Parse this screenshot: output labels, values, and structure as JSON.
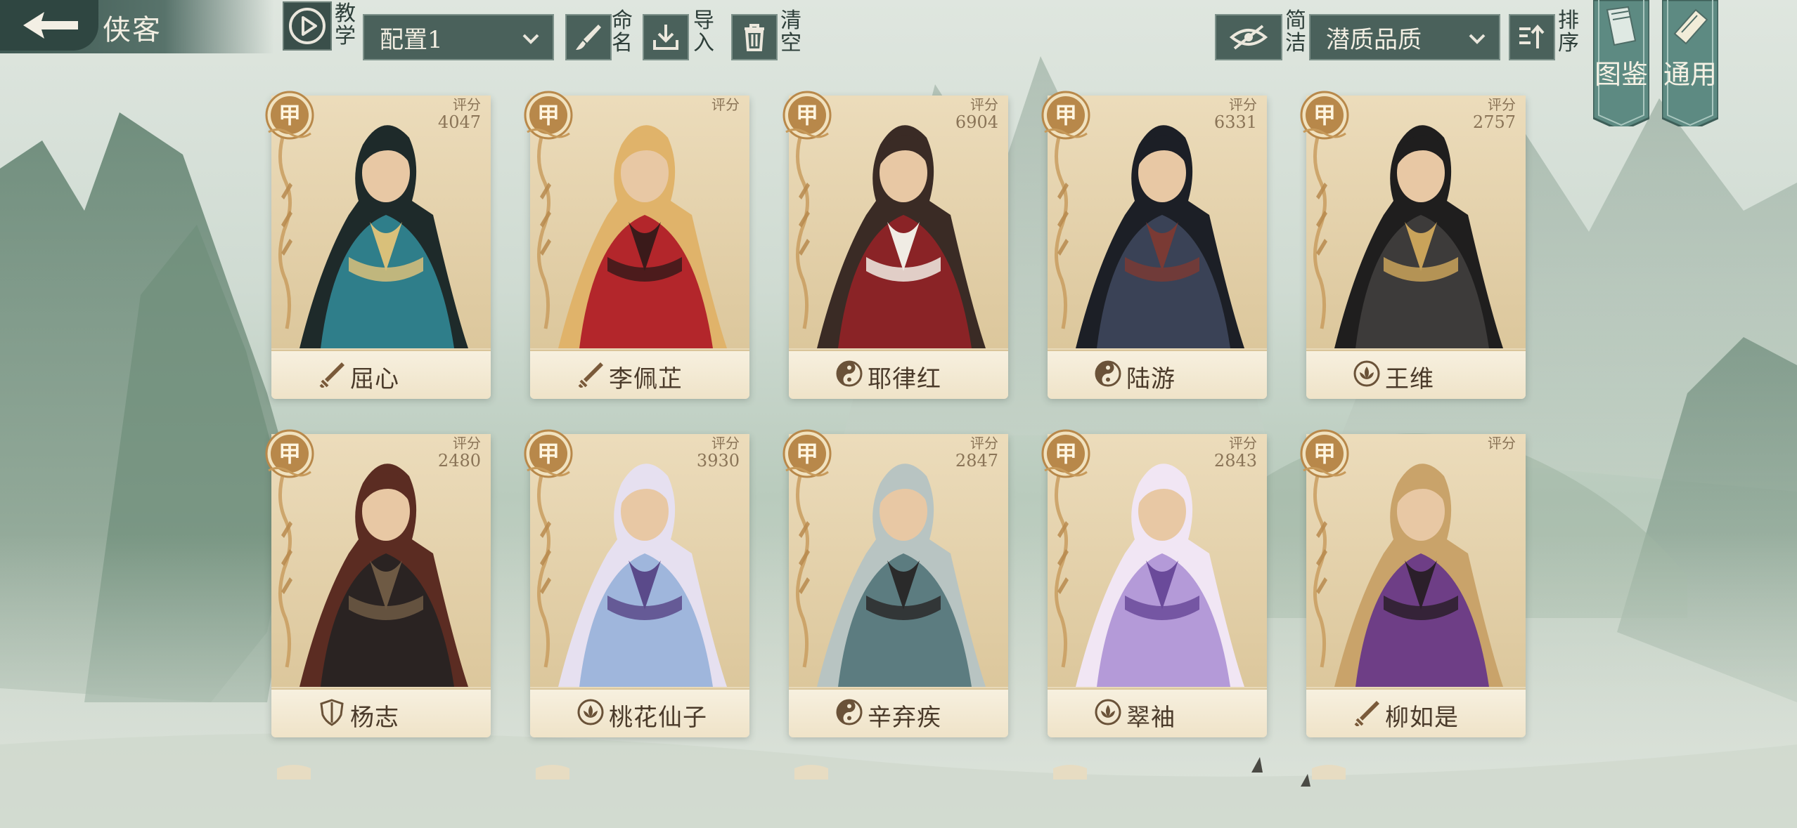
{
  "header": {
    "title": "侠客",
    "tutorial_label": "教学",
    "config_select": "配置1",
    "rename_label": "命名",
    "import_label": "导入",
    "clear_label": "清空",
    "simple_label": "简洁",
    "sort_select": "潜质品质",
    "sort_label": "排序",
    "catalog_label": "图鉴",
    "general_label": "通用"
  },
  "score_label": "评分",
  "cards": [
    {
      "grade": "甲",
      "score": "4047",
      "name": "屈心",
      "type_icon": "sword-icon",
      "palette": [
        "#2f7e8a",
        "#d9c07a",
        "#1e2a2a"
      ]
    },
    {
      "grade": "甲",
      "score": "",
      "name": "李佩芷",
      "type_icon": "sword-icon",
      "palette": [
        "#b3262b",
        "#3a1a1a",
        "#e0b36a"
      ]
    },
    {
      "grade": "甲",
      "score": "6904",
      "name": "耶律红",
      "type_icon": "yinyang-icon",
      "palette": [
        "#8a2326",
        "#f0ece4",
        "#3a2b25"
      ]
    },
    {
      "grade": "甲",
      "score": "6331",
      "name": "陆游",
      "type_icon": "yinyang-icon",
      "palette": [
        "#3a4256",
        "#7a3a34",
        "#1c1f26"
      ]
    },
    {
      "grade": "甲",
      "score": "2757",
      "name": "王维",
      "type_icon": "lotus-icon",
      "palette": [
        "#3d3b3a",
        "#c9a35a",
        "#1f1e1e"
      ]
    },
    {
      "grade": "甲",
      "score": "2480",
      "name": "杨志",
      "type_icon": "shield-icon",
      "palette": [
        "#2a2322",
        "#6e5a44",
        "#5b2c22"
      ]
    },
    {
      "grade": "甲",
      "score": "3930",
      "name": "桃花仙子",
      "type_icon": "lotus-icon",
      "palette": [
        "#9fb6dc",
        "#5a4a8a",
        "#e6e0f0"
      ]
    },
    {
      "grade": "甲",
      "score": "2847",
      "name": "辛弃疾",
      "type_icon": "yinyang-icon",
      "palette": [
        "#5c7c80",
        "#2a2a2a",
        "#b8c4c2"
      ]
    },
    {
      "grade": "甲",
      "score": "2843",
      "name": "翠袖",
      "type_icon": "lotus-icon",
      "palette": [
        "#b49ad8",
        "#6a4a9a",
        "#f1e6f4"
      ]
    },
    {
      "grade": "甲",
      "score": "",
      "name": "柳如是",
      "type_icon": "sword-icon",
      "palette": [
        "#6e3e86",
        "#2b1f2a",
        "#c9a36a"
      ]
    }
  ],
  "colors": {
    "accent_dark": "#2f4641",
    "button_fill": "#4a615b",
    "grade_gold": "#b8884a",
    "card_paper": "#e6d4ae"
  }
}
